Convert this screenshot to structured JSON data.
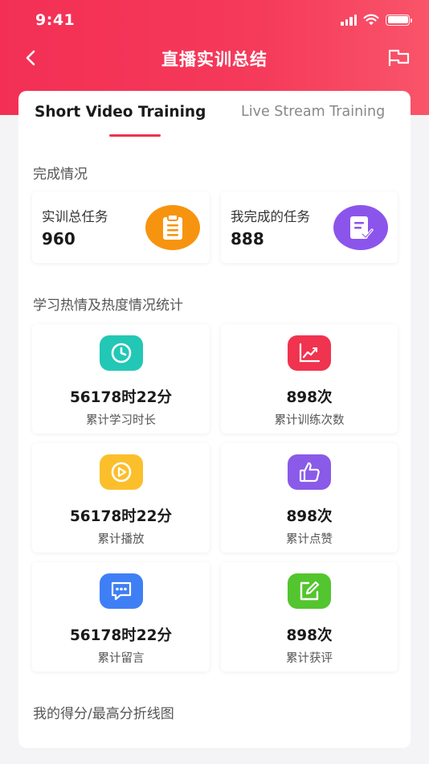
{
  "status_bar": {
    "time": "9:41"
  },
  "nav": {
    "title": "直播实训总结"
  },
  "tabs": [
    {
      "label": "Short Video Training",
      "active": true
    },
    {
      "label": "Live Stream Training",
      "active": false
    }
  ],
  "completion": {
    "title": "完成情况",
    "total": {
      "label": "实训总任务",
      "value": "960",
      "icon": "clipboard-icon",
      "color": "#f7940f"
    },
    "done": {
      "label": "我完成的任务",
      "value": "888",
      "icon": "document-check-icon",
      "color": "#8b55ec"
    }
  },
  "stats": {
    "title": "学习热情及热度情况统计",
    "items": [
      {
        "value": "56178时22分",
        "label": "累计学习时长",
        "icon": "clock-icon",
        "color": "#23c7b5"
      },
      {
        "value": "898次",
        "label": "累计训练次数",
        "icon": "line-chart-icon",
        "color": "#f0334f"
      },
      {
        "value": "56178时22分",
        "label": "累计播放",
        "icon": "play-icon",
        "color": "#fbbf2c"
      },
      {
        "value": "898次",
        "label": "累计点赞",
        "icon": "thumbs-up-icon",
        "color": "#8a5ae8"
      },
      {
        "value": "56178时22分",
        "label": "累计留言",
        "icon": "message-icon",
        "color": "#3f7ff5"
      },
      {
        "value": "898次",
        "label": "累计获评",
        "icon": "edit-icon",
        "color": "#53c52e"
      }
    ]
  },
  "chart_section": {
    "title": "我的得分/最高分折线图"
  }
}
